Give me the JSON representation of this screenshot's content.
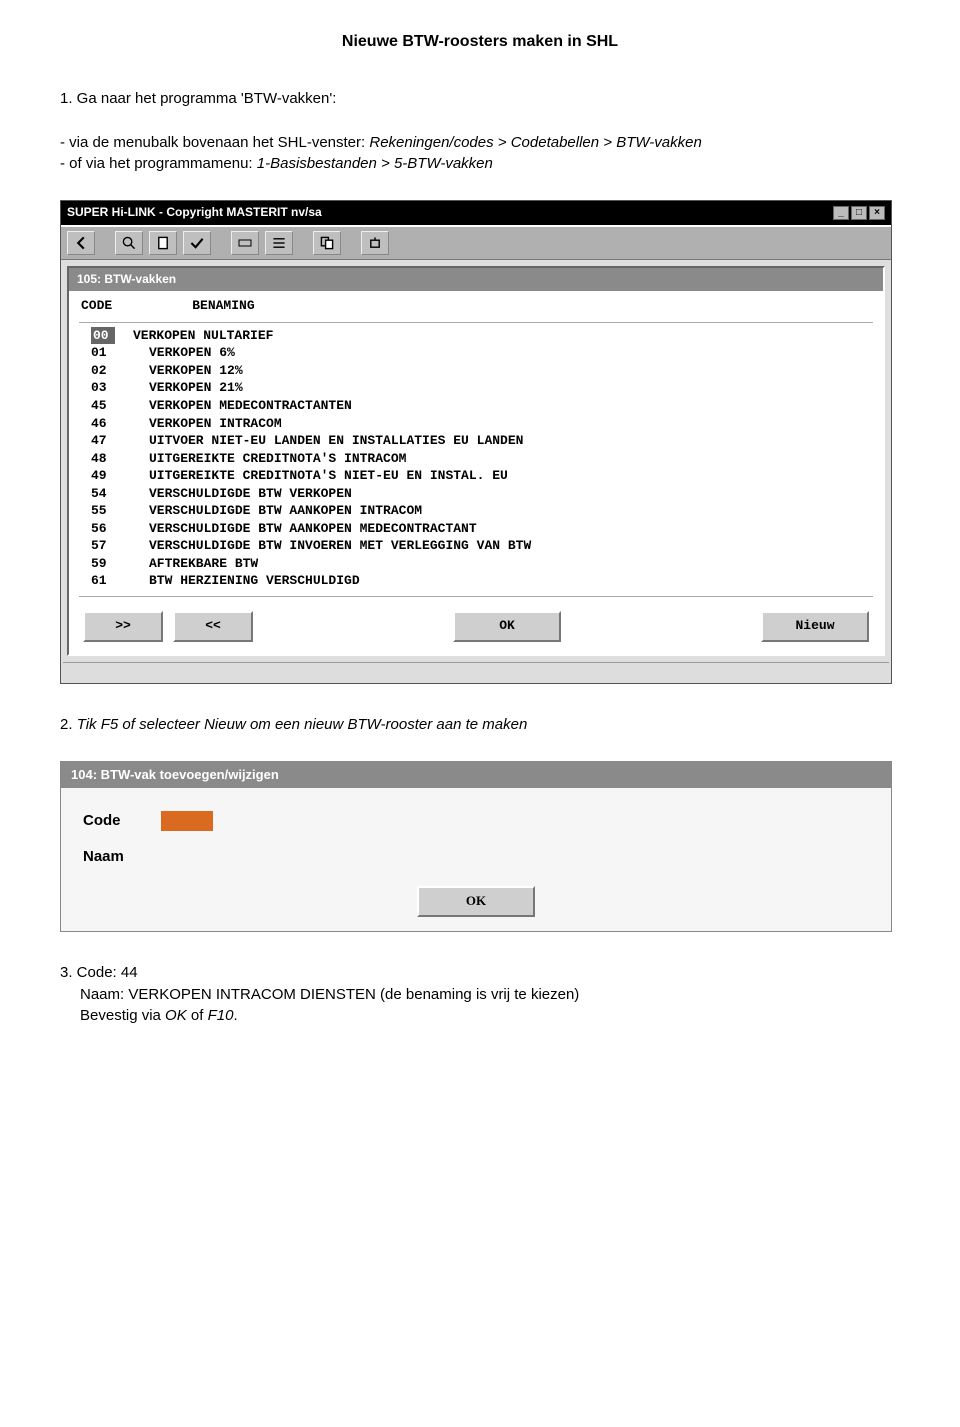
{
  "page_title": "Nieuwe BTW-roosters maken in SHL",
  "step1": {
    "lead": "1. Ga naar het programma 'BTW-vakken':",
    "line_a1": "- via de menubalk bovenaan het SHL-venster: ",
    "line_a2": "Rekeningen/codes > Codetabellen > BTW-vakken",
    "line_b1": "- of via het programmamenu: ",
    "line_b2": "1-Basisbestanden > 5-BTW-vakken"
  },
  "window1": {
    "title": "SUPER Hi-LINK - Copyright MASTERIT nv/sa",
    "panel_title": "105: BTW-vakken",
    "col_code": "CODE",
    "col_name": "BENAMING",
    "rows": [
      {
        "code": "00",
        "name": "VERKOPEN NULTARIEF"
      },
      {
        "code": "01",
        "name": "VERKOPEN 6%"
      },
      {
        "code": "02",
        "name": "VERKOPEN 12%"
      },
      {
        "code": "03",
        "name": "VERKOPEN 21%"
      },
      {
        "code": "45",
        "name": "VERKOPEN MEDECONTRACTANTEN"
      },
      {
        "code": "46",
        "name": "VERKOPEN INTRACOM"
      },
      {
        "code": "47",
        "name": "UITVOER NIET-EU LANDEN EN INSTALLATIES EU LANDEN"
      },
      {
        "code": "48",
        "name": "UITGEREIKTE CREDITNOTA'S INTRACOM"
      },
      {
        "code": "49",
        "name": "UITGEREIKTE CREDITNOTA'S NIET-EU EN INSTAL. EU"
      },
      {
        "code": "54",
        "name": "VERSCHULDIGDE BTW VERKOPEN"
      },
      {
        "code": "55",
        "name": "VERSCHULDIGDE BTW AANKOPEN INTRACOM"
      },
      {
        "code": "56",
        "name": "VERSCHULDIGDE BTW AANKOPEN MEDECONTRACTANT"
      },
      {
        "code": "57",
        "name": "VERSCHULDIGDE BTW INVOEREN MET VERLEGGING VAN BTW"
      },
      {
        "code": "59",
        "name": "AFTREKBARE BTW"
      },
      {
        "code": "61",
        "name": "BTW HERZIENING VERSCHULDIGD"
      }
    ],
    "btn_next": ">>",
    "btn_prev": "<<",
    "btn_ok": "OK",
    "btn_new": "Nieuw"
  },
  "step2": "2. Tik F5 of selecteer Nieuw om een nieuw BTW-rooster aan te maken",
  "window2": {
    "title": "104: BTW-vak toevoegen/wijzigen",
    "label_code": "Code",
    "label_name": "Naam",
    "btn_ok": "OK"
  },
  "step3": {
    "line1": "3. Code: 44",
    "line2": "Naam: VERKOPEN INTRACOM DIENSTEN (de benaming is vrij te kiezen)",
    "line3_a": "Bevestig via ",
    "line3_b": "OK",
    "line3_c": " of ",
    "line3_d": "F10",
    "line3_e": "."
  }
}
